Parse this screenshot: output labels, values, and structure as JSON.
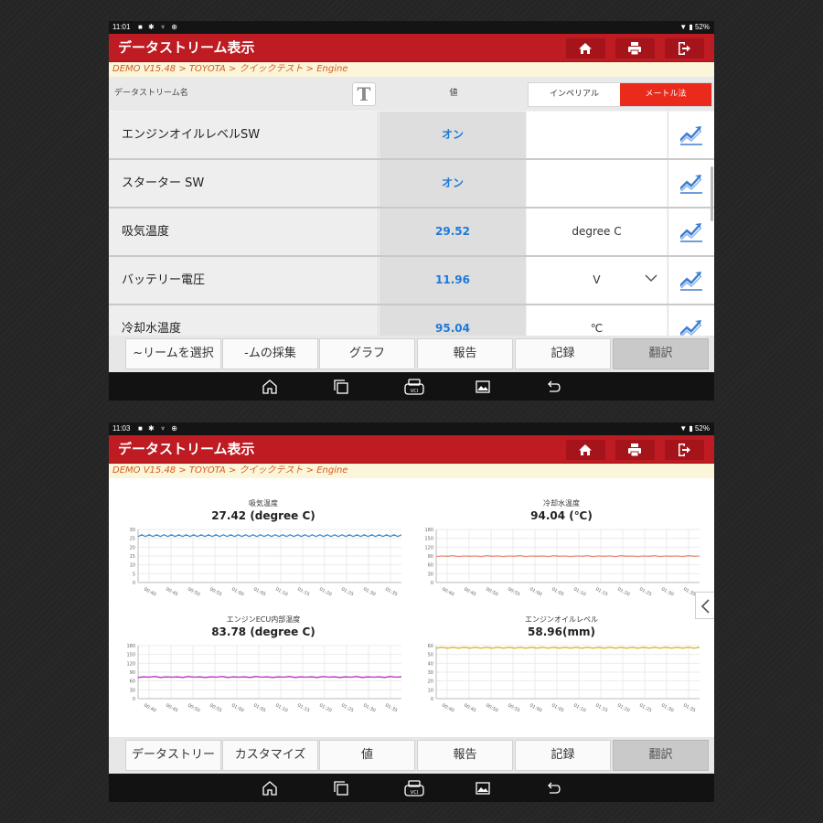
{
  "screen1": {
    "status": {
      "time": "11:01",
      "battery": "52%"
    },
    "title": "データストリーム表示",
    "breadcrumb": "DEMO V15.48 > TOYOTA > クイックテスト > Engine",
    "header": {
      "name_col": "データストリーム名",
      "t_glyph": "T",
      "value_col": "値",
      "imperial": "インペリアル",
      "metric": "メートル法"
    },
    "rows": [
      {
        "name": "エンジンオイルレベルSW",
        "value": "オン",
        "unit": ""
      },
      {
        "name": "スターター SW",
        "value": "オン",
        "unit": ""
      },
      {
        "name": "吸気温度",
        "value": "29.52",
        "unit": "degree C"
      },
      {
        "name": "バッテリー電圧",
        "value": "11.96",
        "unit": "V"
      },
      {
        "name": "冷却水温度",
        "value": "95.04",
        "unit": "℃"
      }
    ],
    "buttons": [
      "~リームを選択",
      "-ムの採集",
      "グラフ",
      "報告",
      "記録",
      "翻訳"
    ]
  },
  "screen2": {
    "status": {
      "time": "11:03",
      "battery": "52%"
    },
    "title": "データストリーム表示",
    "breadcrumb": "DEMO V15.48 > TOYOTA > クイックテスト > Engine",
    "buttons": [
      "データストリー",
      "カスタマイズ",
      "値",
      "報告",
      "記録",
      "翻訳"
    ]
  },
  "icons": {
    "home": "home-icon",
    "print": "print-icon",
    "exit": "exit-icon",
    "graph": "trend-graph-icon",
    "dropdown": "chevron-down-icon",
    "nav": [
      "nav-home-icon",
      "nav-recent-icon",
      "vci-icon",
      "gallery-icon",
      "back-icon"
    ]
  },
  "colors": {
    "titlebar": "#be1b22",
    "metric": "#ea2b1c",
    "value": "#1e7ad9",
    "breadcrumb": "#d65b1f"
  },
  "chart_data": [
    {
      "type": "line",
      "title": "吸気温度",
      "value_label": "27.42 (degree C)",
      "x": [
        "00:40",
        "00:45",
        "00:50",
        "00:55",
        "01:00",
        "01:05",
        "01:10",
        "01:15",
        "01:20",
        "01:25",
        "01:30",
        "01:35"
      ],
      "yticks": [
        0,
        5,
        10,
        15,
        20,
        25,
        30
      ],
      "ylim": [
        0,
        30
      ],
      "series": [
        {
          "color": "#3b86cf",
          "values": [
            26,
            27,
            26,
            27,
            26,
            27,
            26,
            27,
            26,
            27,
            26,
            27,
            26,
            27,
            26,
            27,
            26,
            27,
            26,
            27,
            26,
            27,
            26,
            27,
            26,
            27,
            26,
            27,
            26,
            27,
            26,
            27,
            26,
            27,
            26,
            27,
            26,
            27,
            26,
            27,
            26,
            27,
            26,
            27,
            26,
            27,
            26,
            27,
            26,
            27,
            26,
            27,
            26,
            27,
            26,
            27,
            26,
            27,
            26,
            27,
            26,
            27,
            26,
            27,
            26,
            27,
            26,
            27,
            26,
            27,
            26,
            27
          ]
        }
      ]
    },
    {
      "type": "line",
      "title": "冷却水温度",
      "value_label": "94.04 (℃)",
      "x": [
        "00:40",
        "00:45",
        "00:50",
        "00:55",
        "01:00",
        "01:05",
        "01:10",
        "01:15",
        "01:20",
        "01:25",
        "01:30",
        "01:35"
      ],
      "yticks": [
        0,
        30,
        60,
        90,
        120,
        150,
        180
      ],
      "ylim": [
        0,
        180
      ],
      "series": [
        {
          "color": "#e98a77",
          "values": [
            88,
            90,
            89,
            91,
            88,
            90,
            89,
            90,
            88,
            91,
            89,
            90,
            88,
            90,
            89,
            91,
            88,
            90,
            89,
            90,
            88,
            91,
            89,
            90,
            88,
            90,
            89,
            91,
            88,
            90,
            89,
            90,
            88,
            91,
            89,
            90,
            88,
            90,
            89,
            91,
            88,
            90,
            89,
            90,
            88,
            91,
            89,
            90
          ]
        }
      ]
    },
    {
      "type": "line",
      "title": "エンジンECU内部温度",
      "value_label": "83.78 (degree C)",
      "x": [
        "00:40",
        "00:45",
        "00:50",
        "00:55",
        "01:00",
        "01:05",
        "01:10",
        "01:15",
        "01:20",
        "01:25",
        "01:30",
        "01:35"
      ],
      "yticks": [
        0,
        30,
        60,
        90,
        120,
        150,
        180
      ],
      "ylim": [
        0,
        180
      ],
      "series": [
        {
          "color": "#b52fc1",
          "values": [
            72,
            74,
            73,
            75,
            72,
            74,
            73,
            74,
            72,
            75,
            73,
            74,
            72,
            74,
            73,
            75,
            72,
            74,
            73,
            74,
            72,
            75,
            73,
            74,
            72,
            74,
            73,
            75,
            72,
            74,
            73,
            74,
            72,
            75,
            73,
            74,
            72,
            74,
            73,
            75,
            72,
            74,
            73,
            74,
            72,
            75,
            73,
            74
          ]
        }
      ]
    },
    {
      "type": "line",
      "title": "エンジンオイルレベル",
      "value_label": "58.96(mm)",
      "x": [
        "00:40",
        "00:45",
        "00:50",
        "00:55",
        "01:00",
        "01:05",
        "01:10",
        "01:15",
        "01:20",
        "01:25",
        "01:30",
        "01:35"
      ],
      "yticks": [
        0,
        10,
        20,
        30,
        40,
        50,
        60
      ],
      "ylim": [
        0,
        60
      ],
      "series": [
        {
          "color": "#d9b21a",
          "values": [
            57,
            58,
            57,
            58,
            57,
            58,
            57,
            58,
            57,
            58,
            57,
            58,
            57,
            58,
            57,
            58,
            57,
            58,
            57,
            58,
            57,
            58,
            57,
            58,
            57,
            58,
            57,
            58,
            57,
            58,
            57,
            58,
            57,
            58,
            57,
            58,
            57,
            58,
            57,
            58,
            57,
            58,
            57,
            58,
            57,
            58,
            57,
            58
          ]
        }
      ]
    }
  ]
}
